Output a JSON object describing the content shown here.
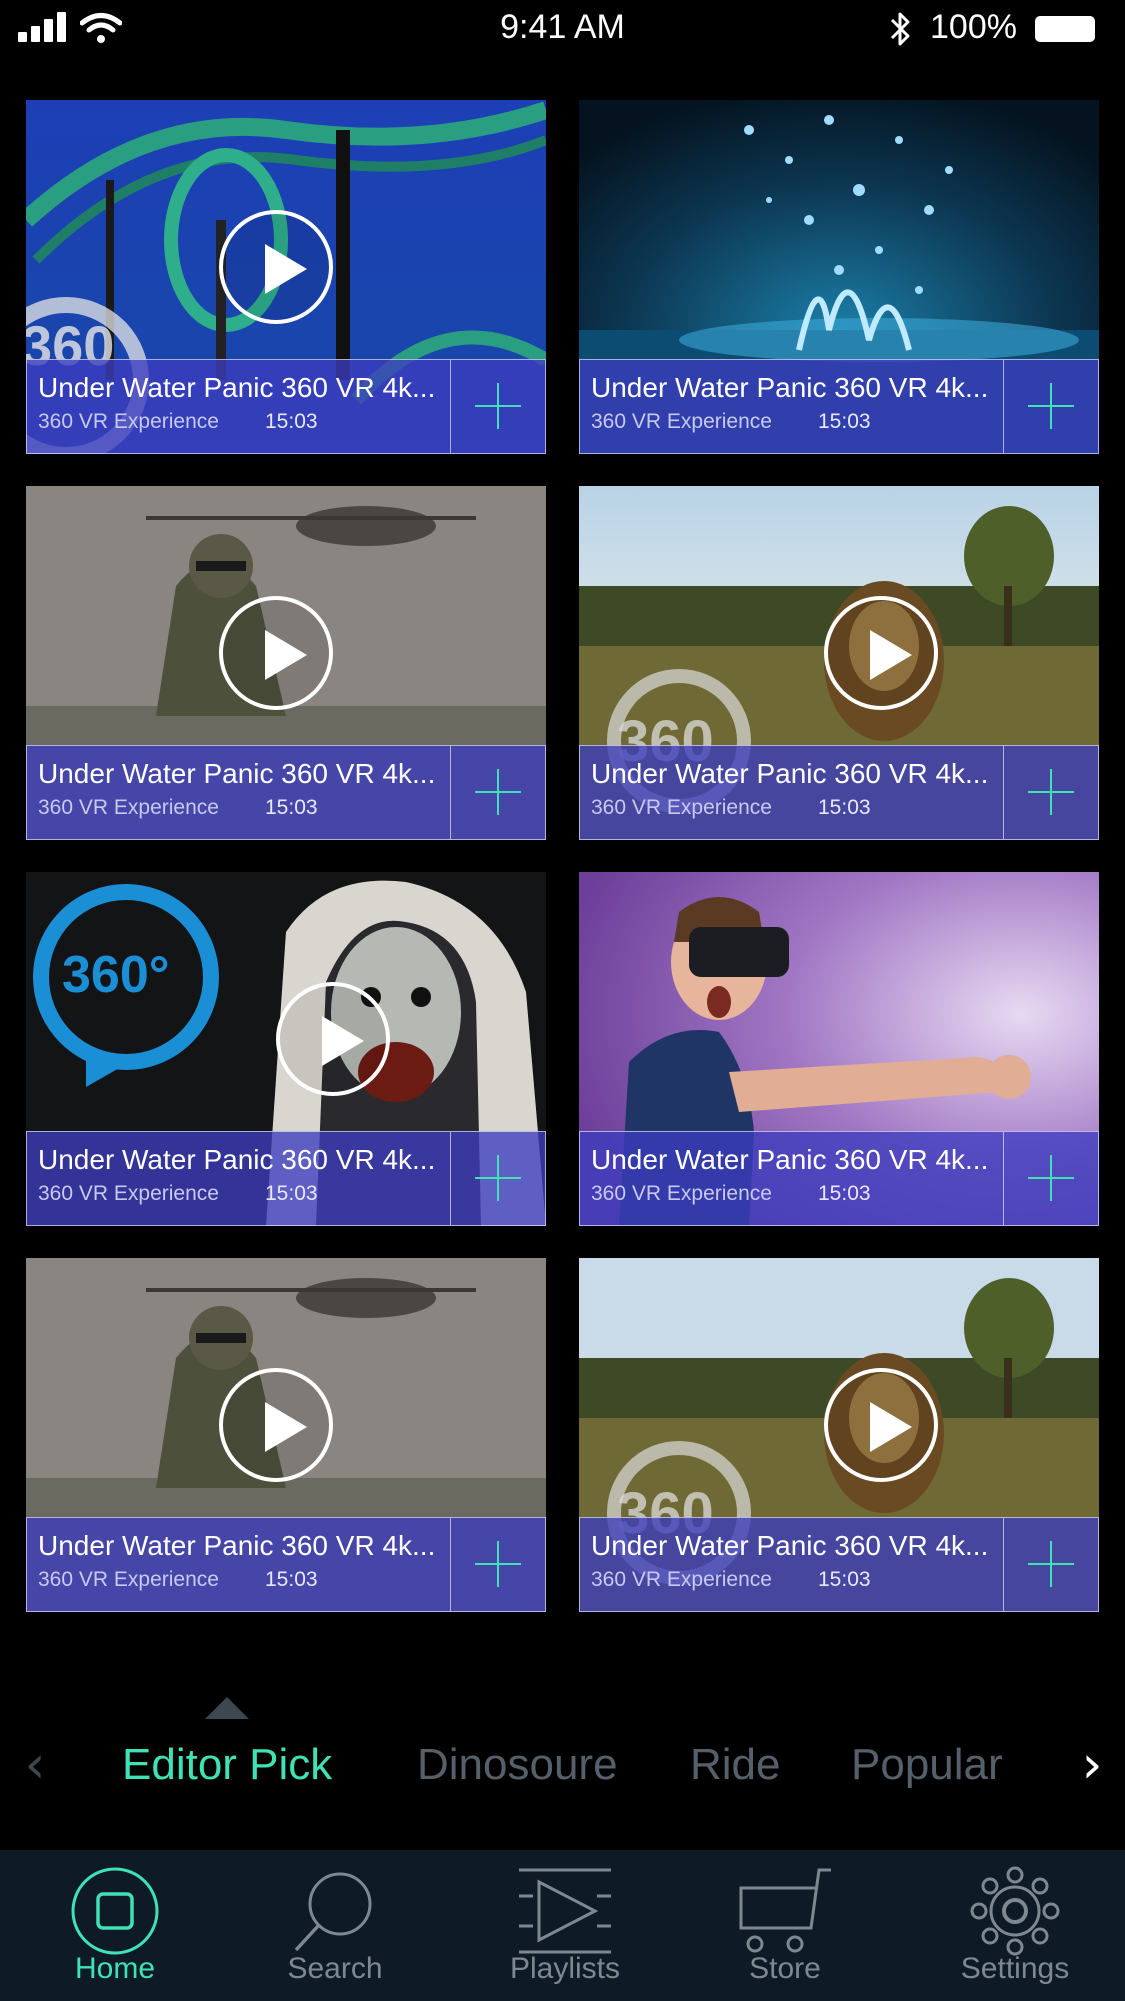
{
  "status_bar": {
    "time": "9:41 AM",
    "battery": "100%",
    "icons": [
      "signal-icon",
      "wifi-icon",
      "bluetooth-icon",
      "battery-icon"
    ]
  },
  "videos": [
    {
      "title": "Under Water Panic 360 VR 4k...",
      "subtitle": "360 VR Experience",
      "duration": "15:03",
      "thumbnail": "roller-coaster-360",
      "has_play": true
    },
    {
      "title": "Under Water Panic 360 VR 4k...",
      "subtitle": "360 VR Experience",
      "duration": "15:03",
      "thumbnail": "water-splash",
      "has_play": false
    },
    {
      "title": "Under Water Panic 360 VR 4k...",
      "subtitle": "360 VR Experience",
      "duration": "15:03",
      "thumbnail": "soldier-helicopter",
      "has_play": true
    },
    {
      "title": "Under Water Panic 360 VR 4k...",
      "subtitle": "360 VR Experience",
      "duration": "15:03",
      "thumbnail": "lion-savanna-360",
      "has_play": true
    },
    {
      "title": "Under Water Panic 360 VR 4k...",
      "subtitle": "360 VR Experience",
      "duration": "15:03",
      "thumbnail": "nun-horror-360",
      "has_play": true
    },
    {
      "title": "Under Water Panic 360 VR 4k...",
      "subtitle": "360 VR Experience",
      "duration": "15:03",
      "thumbnail": "man-vr-headset",
      "has_play": false
    },
    {
      "title": "Under Water Panic 360 VR 4k...",
      "subtitle": "360 VR Experience",
      "duration": "15:03",
      "thumbnail": "soldier-helicopter",
      "has_play": true
    },
    {
      "title": "Under Water Panic 360 VR 4k...",
      "subtitle": "360 VR Experience",
      "duration": "15:03",
      "thumbnail": "lion-savanna-360",
      "has_play": true
    }
  ],
  "categories": {
    "active_index": 0,
    "items": [
      "Editor Pick",
      "Dinosoure",
      "Ride",
      "Popular"
    ]
  },
  "bottom_nav": {
    "active_index": 0,
    "items": [
      {
        "label": "Home",
        "icon": "home-icon"
      },
      {
        "label": "Search",
        "icon": "search-icon"
      },
      {
        "label": "Playlists",
        "icon": "playlists-icon"
      },
      {
        "label": "Store",
        "icon": "cart-icon"
      },
      {
        "label": "Settings",
        "icon": "gear-icon"
      }
    ]
  },
  "colors": {
    "accent": "#3fe2b4",
    "caption_overlay": "#3c3cbe",
    "nav_background": "#0e1a25",
    "inactive_text": "#56606a"
  }
}
